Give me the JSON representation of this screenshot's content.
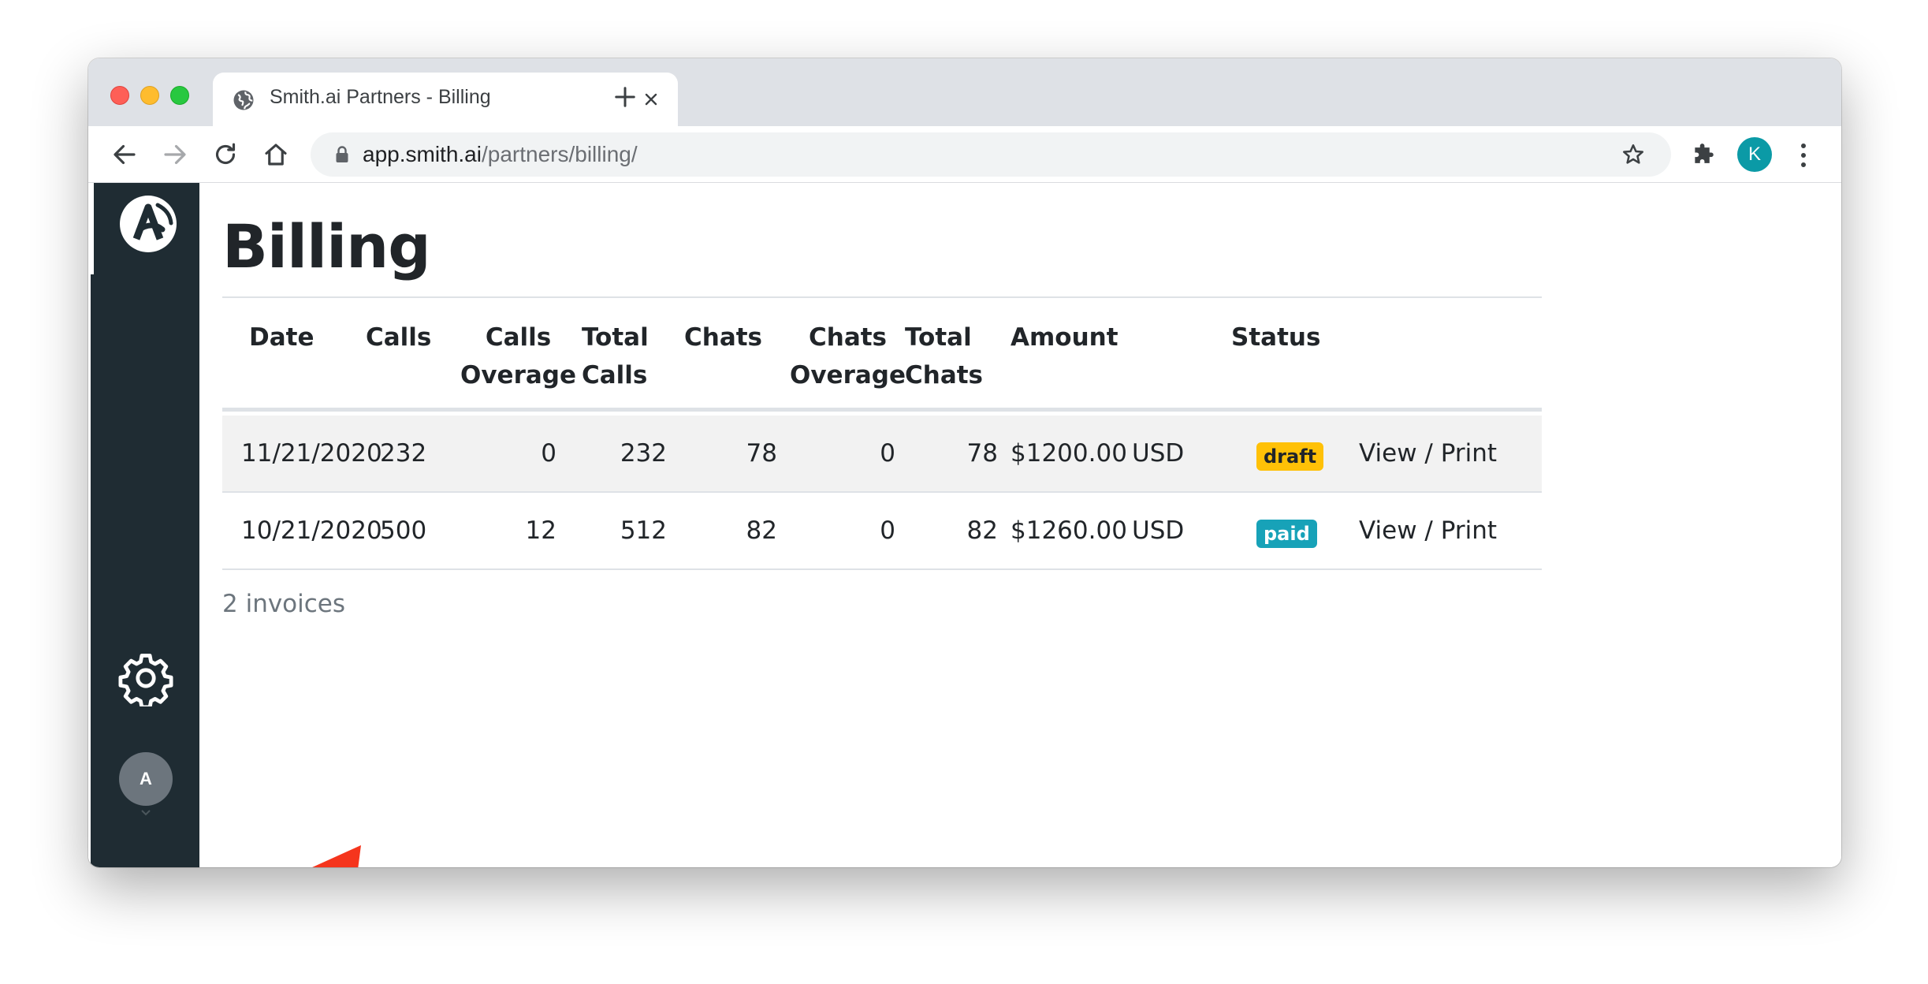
{
  "browser": {
    "tab": {
      "title": "Smith.ai Partners - Billing",
      "icon": "globe-icon"
    },
    "address": {
      "host": "app.smith.ai",
      "path": "/partners/billing/"
    },
    "profile_initial": "K"
  },
  "sidebar": {
    "logo": "smith-ai-logo",
    "settings_icon": "gear-icon",
    "user_initial": "A"
  },
  "page": {
    "title": "Billing",
    "table": {
      "headers": {
        "date": "Date",
        "calls": "Calls",
        "calls_overage": "Calls\nOverage",
        "total_calls": "Total\nCalls",
        "chats": "Chats",
        "chats_overage": "Chats\nOverage",
        "total_chats": "Total\nChats",
        "amount": "Amount",
        "status": "Status"
      },
      "rows": [
        {
          "date": "11/21/2020",
          "calls": "232",
          "calls_overage": "0",
          "total_calls": "232",
          "chats": "78",
          "chats_overage": "0",
          "total_chats": "78",
          "amount": "$1200.00",
          "currency": "USD",
          "status": "draft",
          "action": "View / Print"
        },
        {
          "date": "10/21/2020",
          "calls": "500",
          "calls_overage": "12",
          "total_calls": "512",
          "chats": "82",
          "chats_overage": "0",
          "total_chats": "82",
          "amount": "$1260.00",
          "currency": "USD",
          "status": "paid",
          "action": "View / Print"
        }
      ]
    },
    "count_label": "2 invoices"
  },
  "colors": {
    "sidebar_bg": "#1f2c33",
    "draft_badge": "#ffc107",
    "paid_badge": "#17a2b8",
    "annotation_arrow": "#f5351d",
    "profile_avatar": "#0b9aa6"
  }
}
